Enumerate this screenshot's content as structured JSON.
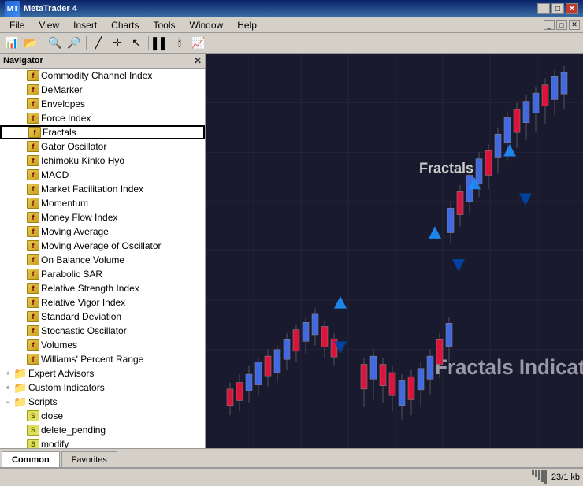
{
  "titleBar": {
    "title": "MetaTrader 4",
    "minBtn": "—",
    "maxBtn": "□",
    "closeBtn": "✕"
  },
  "menuBar": {
    "items": [
      "File",
      "View",
      "Insert",
      "Charts",
      "Tools",
      "Window",
      "Help"
    ]
  },
  "childWindow": {
    "minBtn": "_",
    "restoreBtn": "□",
    "closeBtn": "✕"
  },
  "navigator": {
    "title": "Navigator",
    "indicators": [
      "Commodity Channel Index",
      "DeMarker",
      "Envelopes",
      "Force Index",
      "Fractals",
      "Gator Oscillator",
      "Ichimoku Kinko Hyo",
      "MACD",
      "Market Facilitation Index",
      "Momentum",
      "Money Flow Index",
      "Moving Average",
      "Moving Average of Oscillator",
      "On Balance Volume",
      "Parabolic SAR",
      "Relative Strength Index",
      "Relative Vigor Index",
      "Standard Deviation",
      "Stochastic Oscillator",
      "Volumes",
      "Williams' Percent Range"
    ],
    "sections": [
      "Expert Advisors",
      "Custom Indicators"
    ],
    "scripts": {
      "label": "Scripts",
      "items": [
        "close",
        "delete_pending",
        "modify"
      ]
    }
  },
  "chart": {
    "fractalsLabel": "Fractals",
    "indicatorLabel": "Fractals Indicator"
  },
  "tabs": {
    "common": "Common",
    "favorites": "Favorites"
  },
  "statusBar": {
    "info": "23/1 kb"
  }
}
